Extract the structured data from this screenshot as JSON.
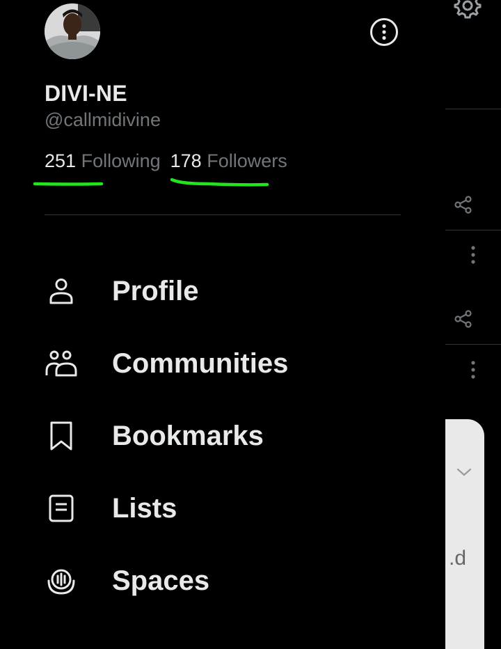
{
  "profile": {
    "display_name": "DIVI-NE",
    "handle": "@callmidivine",
    "following_count": "251",
    "following_label": "Following",
    "followers_count": "178",
    "followers_label": "Followers"
  },
  "menu": {
    "items": [
      {
        "label": "Profile",
        "icon": "person-icon"
      },
      {
        "label": "Communities",
        "icon": "communities-icon"
      },
      {
        "label": "Bookmarks",
        "icon": "bookmark-icon"
      },
      {
        "label": "Lists",
        "icon": "list-icon"
      },
      {
        "label": "Spaces",
        "icon": "spaces-icon"
      }
    ]
  },
  "background": {
    "card_text": "d."
  },
  "colors": {
    "background": "#000000",
    "primary_text": "#e7e9ea",
    "secondary_text": "#71767b",
    "divider": "#2f3336",
    "annotation_highlight": "#22e51d"
  }
}
